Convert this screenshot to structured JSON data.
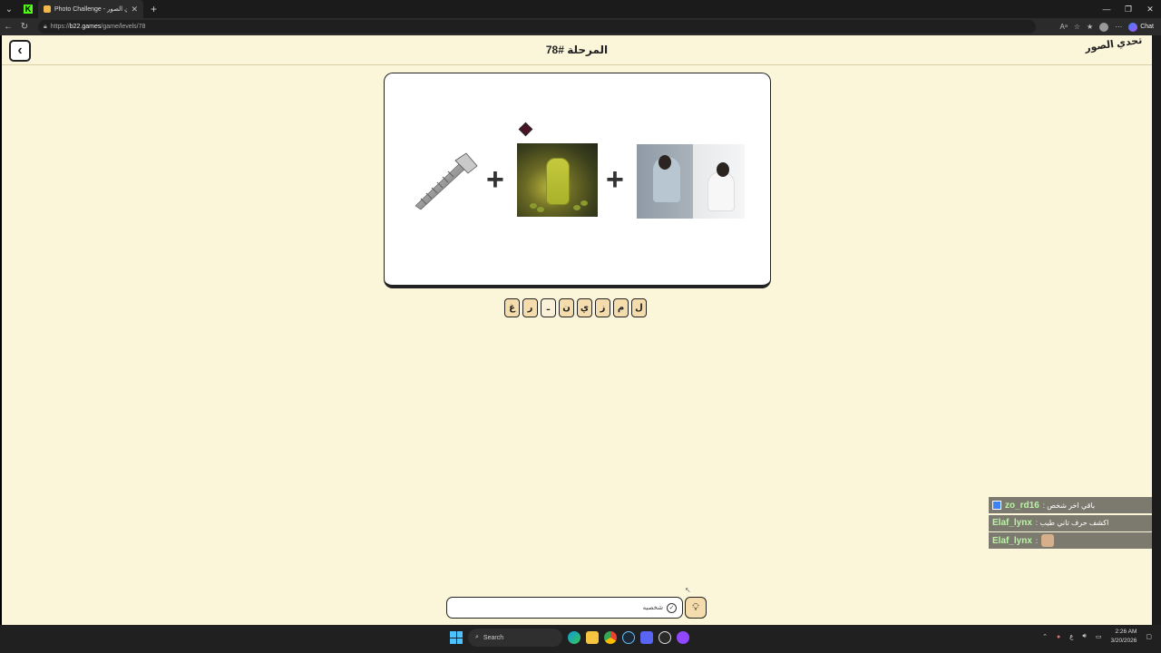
{
  "browser": {
    "tab_title": "Photo Challenge - تحدي الصور",
    "url_domain": "b22.games",
    "url_scheme": "https://",
    "url_path": "/game/levels/78",
    "chat_label": "Chat"
  },
  "header": {
    "level_title": "المرحلة #78",
    "logo_text": "تحدي الصور"
  },
  "puzzle": {
    "plus_sign": "+",
    "letters": [
      "ل",
      "م",
      "ز",
      "ي",
      "ن",
      "ـ",
      "ر",
      "غ"
    ]
  },
  "answer": {
    "value": "شخصيه"
  },
  "chat": {
    "messages": [
      {
        "user": "zo_rd16",
        "text": " : باقي اخر شخص"
      },
      {
        "user": "Elaf_lynx",
        "text": " : اكشف حرف تاني طيب"
      },
      {
        "user": "Elaf_lynx",
        "text": " :"
      }
    ]
  },
  "taskbar": {
    "search_label": "Search",
    "time": "2:26 AM",
    "date": "3/20/2026",
    "lang": "ع"
  }
}
